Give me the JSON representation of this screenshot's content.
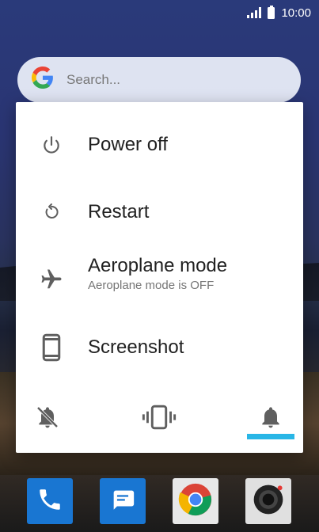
{
  "status_bar": {
    "time": "10:00"
  },
  "search": {
    "placeholder": "Search..."
  },
  "power_menu": {
    "items": [
      {
        "label": "Power off",
        "icon": "power-icon"
      },
      {
        "label": "Restart",
        "icon": "restart-icon"
      },
      {
        "label": "Aeroplane mode",
        "sublabel": "Aeroplane mode is OFF",
        "icon": "airplane-icon"
      },
      {
        "label": "Screenshot",
        "icon": "screenshot-icon"
      }
    ],
    "sound_modes": [
      {
        "name": "mute",
        "icon": "bell-off-icon"
      },
      {
        "name": "vibrate",
        "icon": "vibrate-icon"
      },
      {
        "name": "sound",
        "icon": "bell-icon",
        "selected": true
      }
    ]
  },
  "dock": {
    "apps": [
      {
        "name": "phone",
        "icon": "phone-icon"
      },
      {
        "name": "messages",
        "icon": "messages-icon"
      },
      {
        "name": "chrome",
        "icon": "chrome-icon"
      },
      {
        "name": "camera",
        "icon": "camera-icon"
      }
    ]
  },
  "colors": {
    "accent": "#29b6e6",
    "dialog_bg": "#ffffff",
    "icon_gray": "#5f5f5f"
  }
}
